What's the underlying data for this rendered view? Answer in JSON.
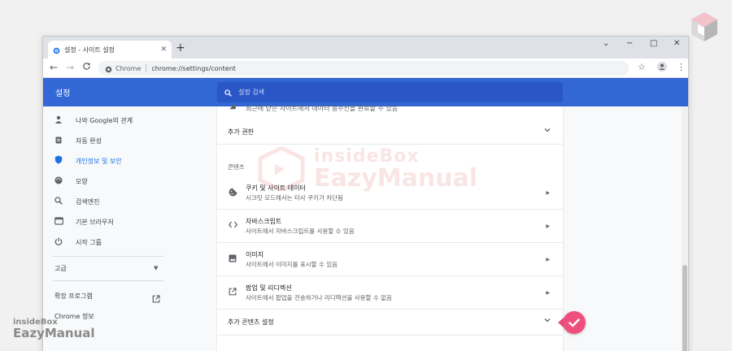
{
  "browser": {
    "tab_title": "설정 - 사이트 설정",
    "tab_close": "✕",
    "new_tab": "+",
    "controls": {
      "minimize": "⌄",
      "min": "−",
      "max": "□",
      "close": "✕"
    },
    "back": "←",
    "forward": "→",
    "reload": "C",
    "omnibox_chip": "Chrome",
    "url": "chrome://settings/content",
    "star": "☆",
    "menu": "⋮"
  },
  "settings": {
    "title": "설정",
    "search_placeholder": "설정 검색"
  },
  "sidebar": {
    "items": [
      {
        "icon": "person-icon",
        "label": "나와 Google의 관계"
      },
      {
        "icon": "clipboard-icon",
        "label": "자동 완성"
      },
      {
        "icon": "shield-icon",
        "label": "개인정보 및 보안",
        "active": true
      },
      {
        "icon": "palette-icon",
        "label": "모양"
      },
      {
        "icon": "search-icon",
        "label": "검색엔진"
      },
      {
        "icon": "browser-icon",
        "label": "기본 브라우저"
      },
      {
        "icon": "power-icon",
        "label": "시작 그룹"
      }
    ],
    "advanced": "고급",
    "extensions": "확장 프로그램",
    "about": "Chrome 정보"
  },
  "main": {
    "top_partial": "최근에 닫은 사이트에서 데이터 송수신을 완료할 수 있음",
    "additional_permissions": "추가 권한",
    "content_section": "콘텐츠",
    "rows": [
      {
        "icon": "cookie-icon",
        "title": "쿠키 및 사이트 데이터",
        "subtitle": "시크릿 모드에서는 타사 쿠키가 차단됨"
      },
      {
        "icon": "code-icon",
        "title": "자바스크립트",
        "subtitle": "사이트에서 자바스크립트를 사용할 수 있음"
      },
      {
        "icon": "image-icon",
        "title": "이미지",
        "subtitle": "사이트에서 이미지를 표시할 수 있음"
      },
      {
        "icon": "popup-icon",
        "title": "팝업 및 리디렉션",
        "subtitle": "사이트에서 팝업을 전송하거나 리디렉션을 사용할 수 없음"
      }
    ],
    "additional_content": "추가 콘텐츠 설정"
  },
  "watermark": {
    "line1": "insideBox",
    "line2": "EazyManual"
  },
  "colors": {
    "accent": "#3367d6",
    "active": "#1a73e8",
    "badge": "#ef4f7e"
  }
}
